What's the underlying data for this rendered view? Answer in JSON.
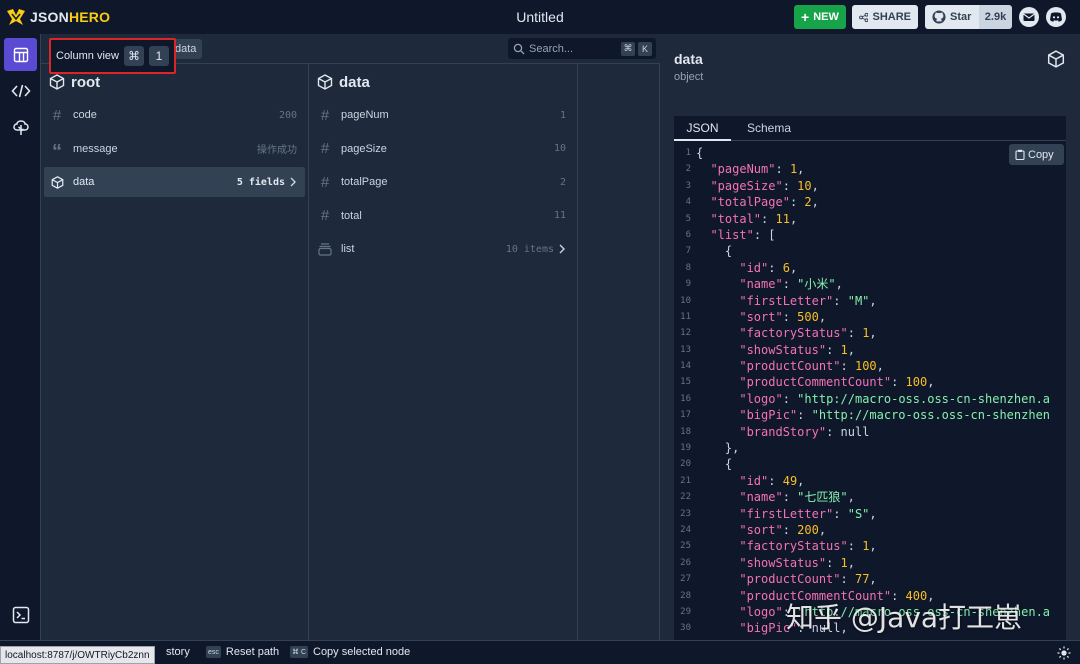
{
  "app": {
    "logo_text_a": "JSON",
    "logo_text_b": "HERO",
    "document_title": "Untitled",
    "buttons": {
      "new_label": "NEW",
      "share_label": "SHARE",
      "star_label": "Star",
      "star_count": "2.9k"
    }
  },
  "path": {
    "crumb_label": "data",
    "search_placeholder": "Search...",
    "search_shortcut_mod": "⌘",
    "search_shortcut_key": "K"
  },
  "tooltip": {
    "label": "Column view",
    "key_mod": "⌘",
    "key": "1"
  },
  "columns": [
    {
      "title": "root",
      "rows": [
        {
          "icon": "hash-icon",
          "label": "code",
          "value": "200"
        },
        {
          "icon": "quote-icon",
          "label": "message",
          "value": "操作成功"
        },
        {
          "icon": "cube-icon",
          "label": "data",
          "value": "5 fields",
          "selected": true
        }
      ]
    },
    {
      "title": "data",
      "rows": [
        {
          "icon": "hash-icon",
          "label": "pageNum",
          "value": "1"
        },
        {
          "icon": "hash-icon",
          "label": "pageSize",
          "value": "10"
        },
        {
          "icon": "hash-icon",
          "label": "totalPage",
          "value": "2"
        },
        {
          "icon": "hash-icon",
          "label": "total",
          "value": "11"
        },
        {
          "icon": "list-icon",
          "label": "list",
          "value": "10 items"
        }
      ]
    }
  ],
  "details": {
    "title": "data",
    "type": "object",
    "tabs": [
      "JSON",
      "Schema"
    ],
    "copy_label": "Copy",
    "code_lines": [
      "{",
      "  \"pageNum\": 1,",
      "  \"pageSize\": 10,",
      "  \"totalPage\": 2,",
      "  \"total\": 11,",
      "  \"list\": [",
      "    {",
      "      \"id\": 6,",
      "      \"name\": \"小米\",",
      "      \"firstLetter\": \"M\",",
      "      \"sort\": 500,",
      "      \"factoryStatus\": 1,",
      "      \"showStatus\": 1,",
      "      \"productCount\": 100,",
      "      \"productCommentCount\": 100,",
      "      \"logo\": \"http://macro-oss.oss-cn-shenzhen.a",
      "      \"bigPic\": \"http://macro-oss.oss-cn-shenzhen",
      "      \"brandStory\": null",
      "    },",
      "    {",
      "      \"id\": 49,",
      "      \"name\": \"七匹狼\",",
      "      \"firstLetter\": \"S\",",
      "      \"sort\": 200,",
      "      \"factoryStatus\": 1,",
      "      \"showStatus\": 1,",
      "      \"productCount\": 77,",
      "      \"productCommentCount\": 400,",
      "      \"logo\": \"http://macro-oss.oss-cn-shenzhen.a",
      "      \"bigPic\": null,"
    ]
  },
  "bottombar": {
    "url": "localhost:8787/j/OWTRiyCb2znn",
    "history_label": "story",
    "reset_kbd": "esc",
    "reset_label": "Reset path",
    "copy_kbd": "⌘ C",
    "copy_label": "Copy selected node"
  },
  "watermark": "知乎 @Java打工崽",
  "colors": {
    "accent": "#5b4bd4",
    "new_button": "#16a34a",
    "highlight_border": "#dc2626"
  }
}
